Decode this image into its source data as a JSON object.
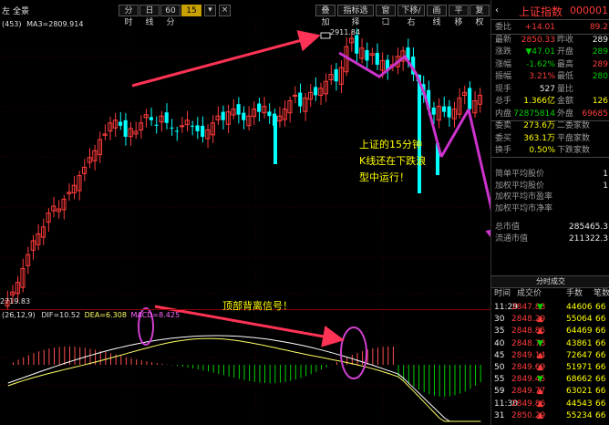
{
  "toolbar": {
    "left_tab": "左",
    "left_tab2": "全景",
    "buttons": [
      "分时",
      "日线",
      "60分",
      "15分"
    ],
    "active": "15分",
    "right_buttons": [
      "叠加",
      "指标选择",
      "窗口",
      "下移/右",
      "画线",
      "平移",
      "复权"
    ],
    "icon_close": "×"
  },
  "indicator_line": {
    "code": "(453)",
    "ma": "MA3=2809.914"
  },
  "price_labels": {
    "high": "2911.84",
    "low": "2719.83"
  },
  "macd_header": {
    "params": "(26,12,9)",
    "dif": "DIF=10.52",
    "dea": "DEA=6.308",
    "macd": "MACD=8.425"
  },
  "annotations": {
    "kline": [
      "上证的15分钟",
      "K线还在下跌浪",
      "型中运行！"
    ],
    "macd": "顶部背离信号！"
  },
  "panel": {
    "title": "上证指数",
    "code": "000001",
    "tag": "R",
    "top_val": "89.2",
    "rows": [
      {
        "l": "委比",
        "v": "+14.01",
        "v_color": "red",
        "l2": "",
        "v2": "89.2",
        "v2_color": "red"
      },
      {
        "l": "最新",
        "v": "2850.33",
        "v_color": "red",
        "l2": "昨收",
        "v2": "289",
        "v2_color": "white"
      },
      {
        "l": "涨跌",
        "v": "▼47.01",
        "v_color": "green",
        "l2": "开盘",
        "v2": "289",
        "v2_color": "green"
      },
      {
        "l": "涨幅",
        "v": "-1.62%",
        "v_color": "green",
        "l2": "最高",
        "v2": "289",
        "v2_color": "red"
      },
      {
        "l": "振幅",
        "v": "3.21%",
        "v_color": "red",
        "l2": "最低",
        "v2": "280",
        "v2_color": "green"
      },
      {
        "l": "现手",
        "v": "527",
        "v_color": "white",
        "l2": "量比",
        "v2": "",
        "v2_color": "white"
      },
      {
        "l": "总手",
        "v": "1.366亿",
        "v_color": "yellow",
        "l2": "金额",
        "v2": "126",
        "v2_color": "yellow"
      },
      {
        "l": "内盘",
        "v": "72875814",
        "v_color": "green",
        "l2": "外盘",
        "v2": "69685",
        "v2_color": "red"
      },
      {
        "l": "委卖",
        "v": "273.6万",
        "v_color": "yellow",
        "l2": "二委家数",
        "v2": "",
        "v2_color": "white"
      },
      {
        "l": "委买",
        "v": "363.1万",
        "v_color": "yellow",
        "l2": "平盘家数",
        "v2": "",
        "v2_color": "white"
      },
      {
        "l": "换手",
        "v": "0.50%",
        "v_color": "yellow",
        "l2": "下跌家数",
        "v2": "",
        "v2_color": "white"
      }
    ],
    "stats": [
      {
        "l": "简单平均股价",
        "v": "1"
      },
      {
        "l": "加权平均股价",
        "v": "1"
      },
      {
        "l": "加权平均市盈率",
        "v": ""
      },
      {
        "l": "加权平均市净率",
        "v": ""
      },
      {
        "l": "总市值",
        "v": "285465.3"
      },
      {
        "l": "流通市值",
        "v": "211322.3"
      }
    ],
    "trades_title": "分时成交",
    "trades_headers": [
      "时间",
      "成交价",
      "手数",
      "笔数"
    ],
    "trades": [
      {
        "t": "11:29",
        "p": "2847.88",
        "d": "▼",
        "q": "44606",
        "n": "66"
      },
      {
        "t": "30",
        "p": "2848.29",
        "d": "▲",
        "q": "55064",
        "n": "66"
      },
      {
        "t": "35",
        "p": "2848.85",
        "d": "▲",
        "q": "64469",
        "n": "66"
      },
      {
        "t": "40",
        "p": "2848.78",
        "d": "▼",
        "q": "43861",
        "n": "66"
      },
      {
        "t": "45",
        "p": "2849.14",
        "d": "▲",
        "q": "72647",
        "n": "66"
      },
      {
        "t": "50",
        "p": "2849.69",
        "d": "▲",
        "q": "51971",
        "n": "66"
      },
      {
        "t": "55",
        "p": "2849.45",
        "d": "▼",
        "q": "68662",
        "n": "66"
      },
      {
        "t": "59",
        "p": "2849.77",
        "d": "▲",
        "q": "63021",
        "n": "66"
      },
      {
        "t": "11:30",
        "p": "2849.86",
        "d": "▲",
        "q": "44543",
        "n": "66"
      },
      {
        "t": "31",
        "p": "2850.29",
        "d": "▲",
        "q": "55234",
        "n": "66"
      }
    ]
  },
  "colors": {
    "up": "#ff3b3b",
    "down": "#00ffff",
    "arrow": "#ff3355",
    "arrow2": "#cc33cc",
    "ma": "#ffffff",
    "dea": "#ffff66",
    "circle": "#d040d0"
  }
}
